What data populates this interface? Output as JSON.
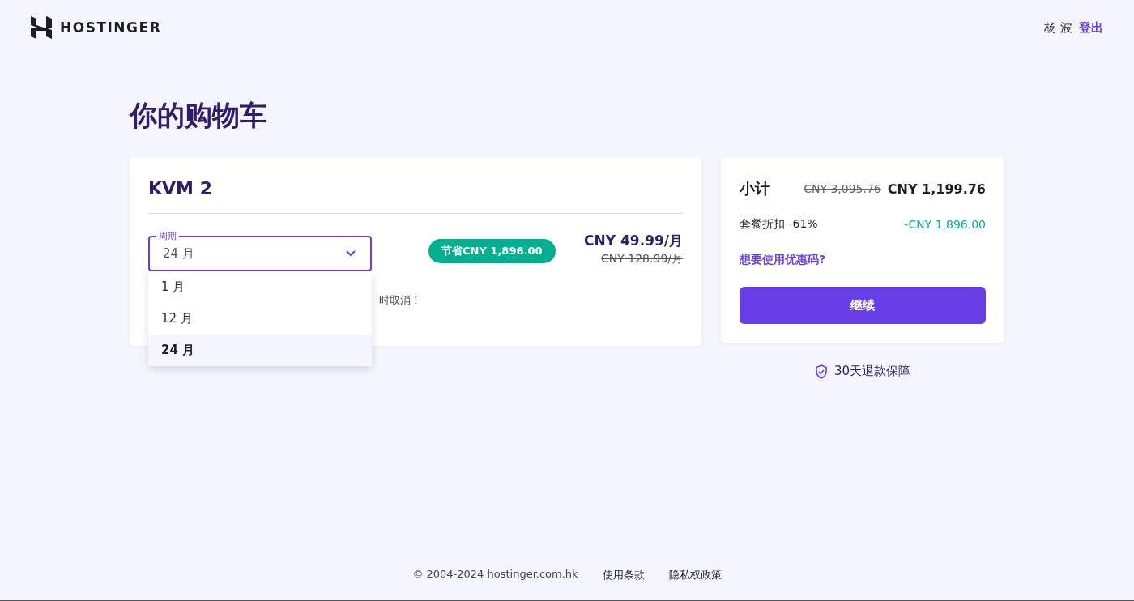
{
  "header": {
    "brand": "HOSTINGER",
    "user": "杨 波",
    "logout": "登出"
  },
  "title": "你的购物车",
  "cart_item": {
    "name": "KVM 2",
    "period_label": "周期",
    "period_value": "24 月",
    "expanded": true,
    "options": [
      {
        "label": "1 月",
        "selected": false
      },
      {
        "label": "12 月",
        "selected": false
      },
      {
        "label": "24 月",
        "selected": true
      }
    ],
    "note": "时取消！",
    "savings_badge": "节省CNY 1,896.00",
    "price": "CNY 49.99/月",
    "old_price": "CNY 128.99/月"
  },
  "summary": {
    "subtotal_label": "小计",
    "subtotal_old": "CNY 3,095.76",
    "subtotal": "CNY 1,199.76",
    "discount_label": "套餐折扣 -61%",
    "discount_value": "-CNY 1,896.00",
    "coupon_link": "想要使用优惠码?",
    "continue_button": "继续"
  },
  "guarantee": "30天退款保障",
  "footer": {
    "copyright": "© 2004-2024 hostinger.com.hk",
    "links": [
      "使用条款",
      "隐私权政策"
    ]
  }
}
